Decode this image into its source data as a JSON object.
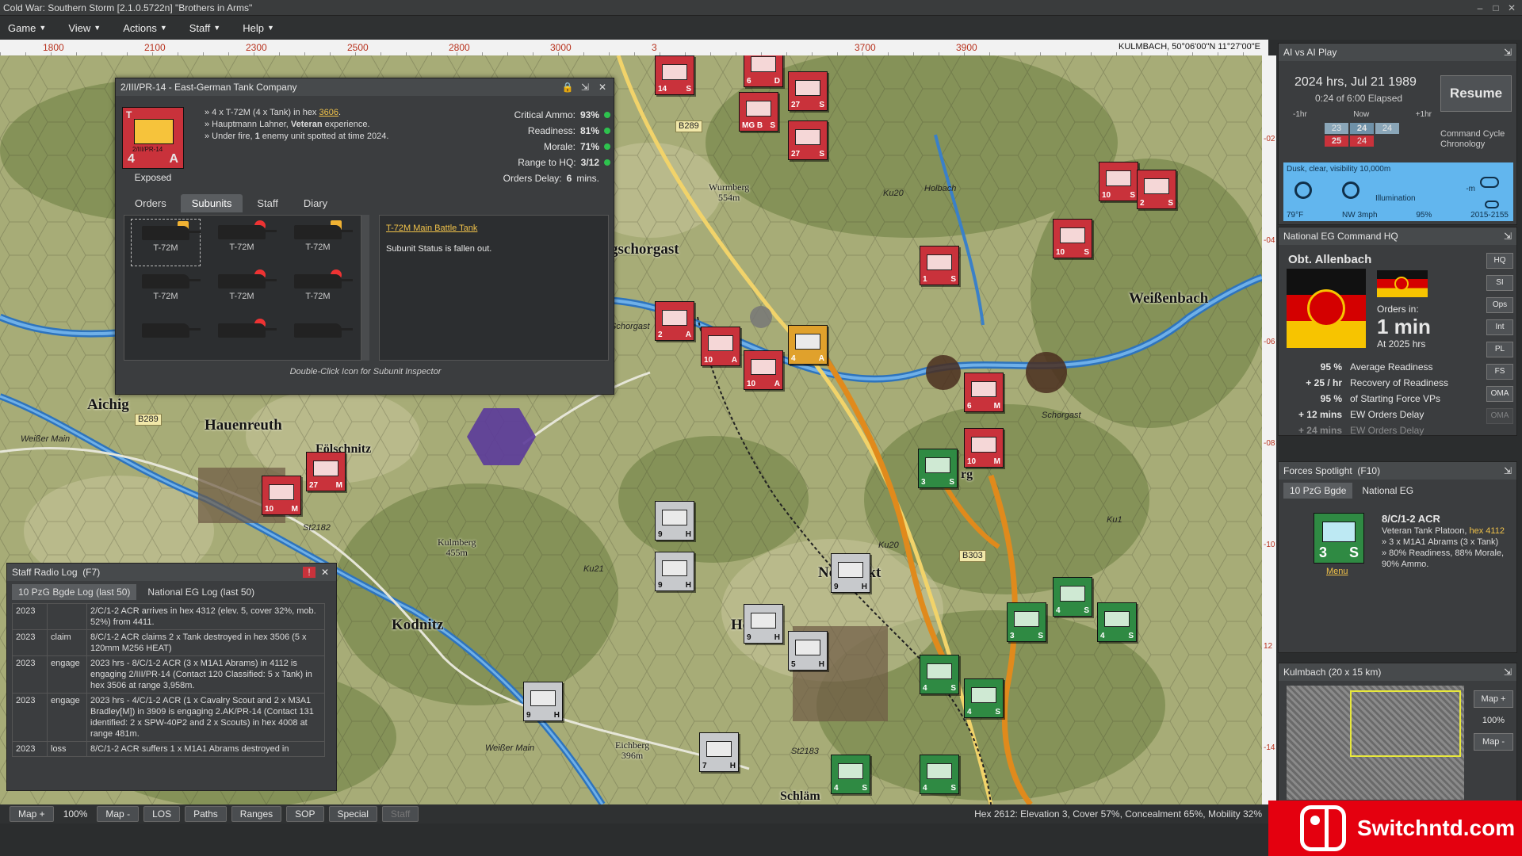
{
  "window": {
    "title": "Cold War: Southern Storm  [2.1.0.5722n]  \"Brothers in Arms\"",
    "min": "–",
    "max": "□",
    "close": "✕"
  },
  "menu": [
    "Game",
    "View",
    "Actions",
    "Staff",
    "Help"
  ],
  "ruler": {
    "ticks": [
      "1800",
      "2100",
      "2300",
      "2500",
      "2800",
      "3000",
      "3",
      "3700",
      "3900"
    ],
    "coord": "KULMBACH, 50°06'00\"N 11°27'00\"E"
  },
  "right_ruler": [
    "-02",
    "-04",
    "-06",
    "-08",
    "-10",
    "12",
    "-14"
  ],
  "map": {
    "towns": [
      {
        "name": "gschorgast",
        "cls": "big"
      },
      {
        "name": "Weißenbach",
        "cls": "big"
      },
      {
        "name": "Aichig",
        "cls": "big"
      },
      {
        "name": "Hauenreuth",
        "cls": "big"
      },
      {
        "name": "Fölschnitz",
        "cls": "mid"
      },
      {
        "name": "Kodnitz",
        "cls": "big"
      },
      {
        "name": "Ne",
        "cls": "big"
      },
      {
        "name": "rkt",
        "cls": "big"
      },
      {
        "name": "He",
        "cls": "big"
      },
      {
        "name": "Wurmberg\n554m",
        "cls": "small"
      },
      {
        "name": "Kulmberg\n455m",
        "cls": "small"
      },
      {
        "name": "Eichberg\n396m",
        "cls": "small"
      },
      {
        "name": "Schläm",
        "cls": "mid"
      },
      {
        "name": "rg",
        "cls": "mid"
      }
    ],
    "roads": [
      "B289",
      "B289",
      "B303",
      "St2182",
      "St2183"
    ],
    "road_labels": [
      "Ku20",
      "Ku20",
      "Ku21",
      "Ku1",
      "Holbach",
      "Schorgast",
      "Weißer Main",
      "Weißer Main",
      "Schorgast"
    ],
    "units": [
      {
        "color": "red",
        "nm": "14",
        "tg": "S"
      },
      {
        "color": "red",
        "nm": "6",
        "tg": "D"
      },
      {
        "color": "red",
        "nm": "27",
        "tg": "S"
      },
      {
        "color": "red",
        "nm": "MG B",
        "tg": "S"
      },
      {
        "color": "red",
        "nm": "27",
        "tg": "S"
      },
      {
        "color": "red",
        "nm": "10",
        "tg": "S"
      },
      {
        "color": "red",
        "nm": "10",
        "tg": "S"
      },
      {
        "color": "red",
        "nm": "2",
        "tg": "S"
      },
      {
        "color": "red",
        "nm": "1",
        "tg": "S"
      },
      {
        "color": "red",
        "nm": "2",
        "tg": "A"
      },
      {
        "color": "red",
        "nm": "10",
        "tg": "A"
      },
      {
        "color": "red",
        "nm": "10",
        "tg": "A"
      },
      {
        "color": "amber",
        "nm": "4",
        "tg": "A"
      },
      {
        "color": "red",
        "nm": "6",
        "tg": "M"
      },
      {
        "color": "red",
        "nm": "10",
        "tg": "M"
      },
      {
        "color": "red",
        "nm": "27",
        "tg": "M"
      },
      {
        "color": "red",
        "nm": "10",
        "tg": "M"
      },
      {
        "color": "green",
        "nm": "3",
        "tg": "S"
      },
      {
        "color": "grey",
        "nm": "9",
        "tg": "H"
      },
      {
        "color": "grey",
        "nm": "9",
        "tg": "H"
      },
      {
        "color": "grey",
        "nm": "9",
        "tg": "H"
      },
      {
        "color": "grey",
        "nm": "9",
        "tg": "H"
      },
      {
        "color": "grey",
        "nm": "5",
        "tg": "H"
      },
      {
        "color": "grey",
        "nm": "9",
        "tg": "H"
      },
      {
        "color": "grey",
        "nm": "7",
        "tg": "H"
      },
      {
        "color": "green",
        "nm": "4",
        "tg": "S"
      },
      {
        "color": "green",
        "nm": "3",
        "tg": "S"
      },
      {
        "color": "green",
        "nm": "4",
        "tg": "S"
      },
      {
        "color": "green",
        "nm": "4",
        "tg": "S"
      },
      {
        "color": "green",
        "nm": "4",
        "tg": "S"
      },
      {
        "color": "green",
        "nm": "4",
        "tg": "S"
      },
      {
        "color": "green",
        "nm": "4",
        "tg": "S"
      }
    ]
  },
  "unit_panel": {
    "title": "2/III/PR-14 - East-German Tank Company",
    "lock_icon": "🔒",
    "pin_icon": "⇲",
    "close_icon": "✕",
    "counter": {
      "top": "T",
      "a": "4",
      "b": "A",
      "name": "2/III/PR-14"
    },
    "status": "Exposed",
    "info": [
      "» 4 x T-72M (4 x Tank) in hex ",
      "3606",
      ".",
      "» Hauptmann Lahner, ",
      "Veteran",
      " experience.",
      "» Under fire, ",
      "1",
      " enemy unit spotted at time 2024."
    ],
    "stats": [
      {
        "label": "Critical Ammo:",
        "value": "93%"
      },
      {
        "label": "Readiness:",
        "value": "81%"
      },
      {
        "label": "Morale:",
        "value": "71%"
      },
      {
        "label": "Range to HQ:",
        "value": "3/12"
      },
      {
        "label": "Orders Delay:",
        "value": "6",
        "unit": "mins."
      }
    ],
    "tabs": [
      "Orders",
      "Subunits",
      "Staff",
      "Diary"
    ],
    "active_tab": "Subunits",
    "subunits": [
      {
        "name": "T-72M",
        "mark": "y"
      },
      {
        "name": "T-72M",
        "mark": "r"
      },
      {
        "name": "T-72M",
        "mark": "y"
      },
      {
        "name": "T-72M",
        "mark": ""
      },
      {
        "name": "T-72M",
        "mark": "r"
      },
      {
        "name": "T-72M",
        "mark": "r"
      },
      {
        "name": "",
        "mark": ""
      },
      {
        "name": "",
        "mark": "r"
      },
      {
        "name": "",
        "mark": ""
      }
    ],
    "detail_link": "T-72M",
    "detail_link2": " Main Battle Tank",
    "detail_text": "Subunit Status is fallen out.",
    "footer": "Double-Click Icon for Subunit Inspector"
  },
  "radio_log": {
    "title": "Staff Radio Log",
    "hotkey": "(F7)",
    "tabs": [
      "10 PzG Bgde Log (last 50)",
      "National EG Log (last 50)"
    ],
    "rows": [
      {
        "time": "2023",
        "type": "",
        "msg": "2/C/1-2 ACR arrives in hex 4312 (elev. 5, cover 32%, mob. 52%) from 4411."
      },
      {
        "time": "2023",
        "type": "claim",
        "msg": "8/C/1-2 ACR claims 2 x Tank destroyed in hex 3506 (5 x 120mm M256 HEAT)"
      },
      {
        "time": "2023",
        "type": "engage",
        "msg": "2023 hrs - 8/C/1-2 ACR (3 x M1A1 Abrams) in 4112 is engaging 2/III/PR-14 (Contact 120 Classified: 5 x Tank) in hex 3506 at range 3,958m."
      },
      {
        "time": "2023",
        "type": "engage",
        "msg": "2023 hrs - 4/C/1-2 ACR (1 x Cavalry Scout and 2 x M3A1 Bradley[M]) in 3909 is engaging 2.AK/PR-14 (Contact 131 identified: 2 x SPW-40P2 and 2 x Scouts) in hex 4008 at range 481m."
      },
      {
        "time": "2023",
        "type": "loss",
        "msg": "8/C/1-2 ACR suffers 1 x M1A1 Abrams destroyed in"
      }
    ]
  },
  "ai_play": {
    "title": "AI vs AI Play",
    "time": "2024 hrs, Jul 21 1989",
    "elapsed": "0:24 of 6:00 Elapsed",
    "resume": "Resume",
    "scale": [
      "-1hr",
      "Now",
      "+1hr"
    ],
    "chron_top": [
      "23",
      "24",
      "24"
    ],
    "chron_bot": [
      "25",
      "24"
    ],
    "cc_label1": "Command Cycle",
    "cc_label2": "Chronology",
    "weather": "Dusk, clear, visibility 10,000m",
    "temp": "79°F",
    "wind": "NW 3mph",
    "illum_label": "Illumination",
    "illum": "95%",
    "m_label": "-m",
    "window": "2015-2155"
  },
  "hq": {
    "title": "National EG Command HQ",
    "name": "Obt. Allenbach",
    "orders_in": "Orders in:",
    "minutes": "1 min",
    "at": "At 2025 hrs",
    "stats": [
      {
        "v": "95 %",
        "l": "Average Readiness"
      },
      {
        "v": "+ 25 / hr",
        "l": "Recovery of Readiness"
      },
      {
        "v": "95 %",
        "l": "of Starting Force VPs"
      },
      {
        "v": "+ 12 mins",
        "l": "EW Orders Delay"
      },
      {
        "v": "+ 24 mins",
        "l": "EW Orders Delay"
      }
    ],
    "buttons": [
      "HQ",
      "SI",
      "Ops",
      "Int",
      "PL",
      "FS",
      "OMA",
      "OMA"
    ]
  },
  "spotlight": {
    "title": "Forces Spotlight",
    "hotkey": "(F10)",
    "tabs": [
      "10 PzG Bgde",
      "National EG"
    ],
    "counter": {
      "a": "3",
      "b": "S"
    },
    "menu": "Menu",
    "name": "8/C/1-2 ACR",
    "desc1": "Veteran Tank Platoon, ",
    "desc_hex": "hex 4112",
    "desc2": "» 3 x M1A1 Abrams (3 x Tank)",
    "desc3": "» 80% Readiness, 88% Morale, 90% Ammo."
  },
  "minimap": {
    "title": "Kulmbach (20 x 15 km)",
    "btn_plus": "Map +",
    "zoom": "100%",
    "btn_minus": "Map -"
  },
  "bottom": {
    "buttons": [
      "Map +",
      "100%",
      "Map -",
      "LOS",
      "Paths",
      "Ranges",
      "SOP",
      "Special",
      "Staff"
    ],
    "hexinfo": "Hex 2612: Elevation 3, Cover 57%, Concealment 65%, Mobility 32%"
  },
  "watermark": "Switchntd.com",
  "colors": {
    "opfor": "#c9323b",
    "blufor": "#2f8a43",
    "neutral": "#c7c9cc",
    "highlight": "#f0c24a"
  }
}
